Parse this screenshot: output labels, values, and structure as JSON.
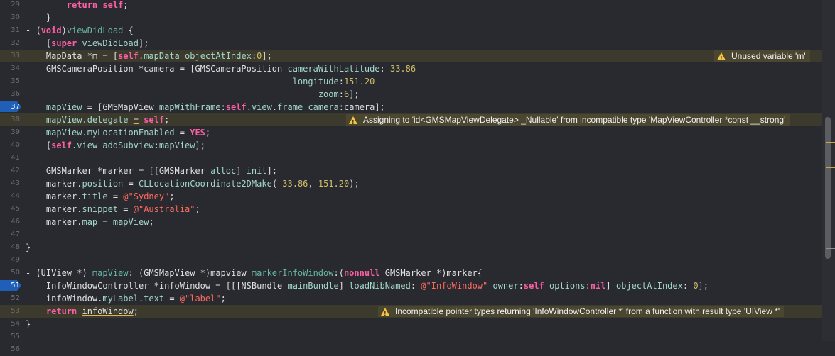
{
  "lines": [
    {
      "n": "29",
      "segs": [
        [
          "kw",
          "        return"
        ],
        [
          "pl",
          " "
        ],
        [
          "kw",
          "self"
        ],
        [
          "pl",
          ";"
        ]
      ]
    },
    {
      "n": "30",
      "segs": [
        [
          "pl",
          "    }"
        ]
      ]
    },
    {
      "n": "31",
      "segs": [
        [
          "pl",
          "- ("
        ],
        [
          "kw",
          "void"
        ],
        [
          "pl",
          ")"
        ],
        [
          "meth",
          "viewDidLoad"
        ],
        [
          "pl",
          " {"
        ]
      ]
    },
    {
      "n": "32",
      "segs": [
        [
          "pl",
          "    ["
        ],
        [
          "kw",
          "super"
        ],
        [
          "pl",
          " "
        ],
        [
          "mt2",
          "viewDidLoad"
        ],
        [
          "pl",
          "];"
        ]
      ]
    },
    {
      "n": "33",
      "warn": true,
      "segs": [
        [
          "pl",
          "    MapData *"
        ],
        [
          "ul",
          "m"
        ],
        [
          "pl",
          " = ["
        ],
        [
          "kw",
          "self"
        ],
        [
          "pl",
          "."
        ],
        [
          "mt2",
          "mapData"
        ],
        [
          "pl",
          " "
        ],
        [
          "mt2",
          "objectAtIndex"
        ],
        [
          "pl",
          ":"
        ],
        [
          "num",
          "0"
        ],
        [
          "pl",
          "];"
        ]
      ]
    },
    {
      "n": "34",
      "segs": [
        [
          "pl",
          "    GMSCameraPosition *camera = [GMSCameraPosition "
        ],
        [
          "mt2",
          "cameraWithLatitude"
        ],
        [
          "pl",
          ":"
        ],
        [
          "num",
          "-33.86"
        ]
      ]
    },
    {
      "n": "35",
      "segs": [
        [
          "pl",
          "                                                    "
        ],
        [
          "mt2",
          "longitude"
        ],
        [
          "pl",
          ":"
        ],
        [
          "num",
          "151.20"
        ]
      ]
    },
    {
      "n": "36",
      "segs": [
        [
          "pl",
          "                                                         "
        ],
        [
          "mt2",
          "zoom"
        ],
        [
          "pl",
          ":"
        ],
        [
          "num",
          "6"
        ],
        [
          "pl",
          "];"
        ]
      ]
    },
    {
      "n": "37",
      "bp": true,
      "segs": [
        [
          "pl",
          "    "
        ],
        [
          "mt2",
          "mapView"
        ],
        [
          "pl",
          " = [GMSMapView "
        ],
        [
          "mt2",
          "mapWithFrame"
        ],
        [
          "pl",
          ":"
        ],
        [
          "kw",
          "self"
        ],
        [
          "pl",
          "."
        ],
        [
          "mt2",
          "view"
        ],
        [
          "pl",
          "."
        ],
        [
          "mt2",
          "frame"
        ],
        [
          "pl",
          " "
        ],
        [
          "mt2",
          "camera"
        ],
        [
          "pl",
          ":camera];"
        ]
      ]
    },
    {
      "n": "38",
      "warn": true,
      "segs": [
        [
          "pl",
          "    "
        ],
        [
          "mt2",
          "mapView"
        ],
        [
          "pl",
          "."
        ],
        [
          "mt2",
          "delegate"
        ],
        [
          "pl",
          " "
        ],
        [
          "ul",
          "="
        ],
        [
          "pl",
          " "
        ],
        [
          "kw",
          "self"
        ],
        [
          "pl",
          ";"
        ]
      ]
    },
    {
      "n": "39",
      "segs": [
        [
          "pl",
          "    "
        ],
        [
          "mt2",
          "mapView"
        ],
        [
          "pl",
          "."
        ],
        [
          "mt2",
          "myLocationEnabled"
        ],
        [
          "pl",
          " = "
        ],
        [
          "kw",
          "YES"
        ],
        [
          "pl",
          ";"
        ]
      ]
    },
    {
      "n": "40",
      "segs": [
        [
          "pl",
          "    ["
        ],
        [
          "kw",
          "self"
        ],
        [
          "pl",
          "."
        ],
        [
          "mt2",
          "view"
        ],
        [
          "pl",
          " "
        ],
        [
          "mt2",
          "addSubview"
        ],
        [
          "pl",
          ":"
        ],
        [
          "mt2",
          "mapView"
        ],
        [
          "pl",
          "];"
        ]
      ]
    },
    {
      "n": "41",
      "segs": []
    },
    {
      "n": "42",
      "segs": [
        [
          "pl",
          "    GMSMarker *marker = [[GMSMarker "
        ],
        [
          "mt2",
          "alloc"
        ],
        [
          "pl",
          "] "
        ],
        [
          "mt2",
          "init"
        ],
        [
          "pl",
          "];"
        ]
      ]
    },
    {
      "n": "43",
      "segs": [
        [
          "pl",
          "    marker."
        ],
        [
          "mt2",
          "position"
        ],
        [
          "pl",
          " = "
        ],
        [
          "mt2",
          "CLLocationCoordinate2DMake"
        ],
        [
          "pl",
          "("
        ],
        [
          "num",
          "-33.86"
        ],
        [
          "pl",
          ", "
        ],
        [
          "num",
          "151.20"
        ],
        [
          "pl",
          ");"
        ]
      ]
    },
    {
      "n": "44",
      "segs": [
        [
          "pl",
          "    marker."
        ],
        [
          "mt2",
          "title"
        ],
        [
          "pl",
          " = "
        ],
        [
          "str",
          "@\"Sydney\""
        ],
        [
          "pl",
          ";"
        ]
      ]
    },
    {
      "n": "45",
      "segs": [
        [
          "pl",
          "    marker."
        ],
        [
          "mt2",
          "snippet"
        ],
        [
          "pl",
          " = "
        ],
        [
          "str",
          "@\"Australia\""
        ],
        [
          "pl",
          ";"
        ]
      ]
    },
    {
      "n": "46",
      "segs": [
        [
          "pl",
          "    marker."
        ],
        [
          "mt2",
          "map"
        ],
        [
          "pl",
          " = "
        ],
        [
          "mt2",
          "mapView"
        ],
        [
          "pl",
          ";"
        ]
      ]
    },
    {
      "n": "47",
      "segs": []
    },
    {
      "n": "48",
      "segs": [
        [
          "pl",
          "}"
        ]
      ]
    },
    {
      "n": "49",
      "segs": []
    },
    {
      "n": "50",
      "segs": [
        [
          "pl",
          "- (UIView *) "
        ],
        [
          "meth",
          "mapView"
        ],
        [
          "pl",
          ": (GMSMapView *)mapview "
        ],
        [
          "meth",
          "markerInfoWindow"
        ],
        [
          "pl",
          ":("
        ],
        [
          "kw",
          "nonnull"
        ],
        [
          "pl",
          " GMSMarker *)marker{"
        ]
      ]
    },
    {
      "n": "51",
      "bp": true,
      "segs": [
        [
          "pl",
          "    InfoWindowController *infoWindow = [[[NSBundle "
        ],
        [
          "mt2",
          "mainBundle"
        ],
        [
          "pl",
          "] "
        ],
        [
          "mt2",
          "loadNibNamed"
        ],
        [
          "pl",
          ": "
        ],
        [
          "str",
          "@\"InfoWindow\""
        ],
        [
          "pl",
          " "
        ],
        [
          "mt2",
          "owner"
        ],
        [
          "pl",
          ":"
        ],
        [
          "kw",
          "self"
        ],
        [
          "pl",
          " "
        ],
        [
          "mt2",
          "options"
        ],
        [
          "pl",
          ":"
        ],
        [
          "kw",
          "nil"
        ],
        [
          "pl",
          "] "
        ],
        [
          "mt2",
          "objectAtIndex"
        ],
        [
          "pl",
          ": "
        ],
        [
          "num",
          "0"
        ],
        [
          "pl",
          "];"
        ]
      ]
    },
    {
      "n": "52",
      "segs": [
        [
          "pl",
          "    infoWindow."
        ],
        [
          "mt2",
          "myLabel"
        ],
        [
          "pl",
          "."
        ],
        [
          "mt2",
          "text"
        ],
        [
          "pl",
          " = "
        ],
        [
          "str",
          "@\"label\""
        ],
        [
          "pl",
          ";"
        ]
      ]
    },
    {
      "n": "53",
      "warn": true,
      "segs": [
        [
          "kw",
          "    return"
        ],
        [
          "pl",
          " "
        ],
        [
          "ul",
          "infoWindow"
        ],
        [
          "pl",
          ";"
        ]
      ]
    },
    {
      "n": "54",
      "segs": [
        [
          "pl",
          "}"
        ]
      ]
    },
    {
      "n": "55",
      "segs": []
    },
    {
      "n": "56",
      "segs": []
    }
  ],
  "warnings": [
    {
      "line": "33",
      "text": "Unused variable 'm'"
    },
    {
      "line": "38",
      "text": "Assigning to 'id<GMSMapViewDelegate> _Nullable' from incompatible type 'MapViewController *const __strong'"
    },
    {
      "line": "53",
      "text": "Incompatible pointer types returning 'InfoWindowController *' from a function with result type 'UIView *'"
    }
  ],
  "icons": {
    "warning": "warning-triangle-icon",
    "breakpoint": "breakpoint-marker-icon"
  },
  "colors": {
    "background": "#292a30",
    "keyword": "#fc5fa3",
    "string": "#fc6a5d",
    "number": "#d0bf69",
    "method": "#67b7a4",
    "warning": "#f4c445",
    "breakpoint": "#1f5fb8"
  }
}
